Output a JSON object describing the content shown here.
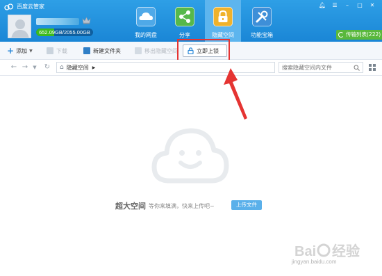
{
  "app": {
    "title": "百度云管家"
  },
  "user": {
    "quota_text": "652.09GB/2055.00GB",
    "quota_used_fraction": 0.317
  },
  "nav_tabs": [
    {
      "label": "我的网盘",
      "icon": "cloud-icon",
      "color": "#4fa9e8"
    },
    {
      "label": "分享",
      "icon": "share-icon",
      "color": "#56b84b"
    },
    {
      "label": "隐藏空间",
      "icon": "lock-icon",
      "color": "#f0b22b",
      "active": true
    },
    {
      "label": "功能宝箱",
      "icon": "tools-icon",
      "color": "#3e8fd8"
    }
  ],
  "transfer_list": {
    "label": "传输列表(222)"
  },
  "toolbar": {
    "add_label": "添加",
    "download_label": "下载",
    "new_folder_label": "新建文件夹",
    "move_out_label": "移出隐藏空间",
    "upload_now_label": "立即上锁"
  },
  "addressbar": {
    "breadcrumb": "隐藏空间",
    "search_placeholder": "搜索隐藏空间内文件"
  },
  "empty_state": {
    "headline": "超大空间",
    "subtext": "等你来填满，快来上传吧~",
    "upload_button": "上传文件"
  },
  "watermark": {
    "text": "jingyan.baidu.com"
  },
  "colors": {
    "header": "#1e8ddd",
    "accent": "#5ab0ea",
    "annotation": "#e53432",
    "transfer": "#59b83c"
  }
}
